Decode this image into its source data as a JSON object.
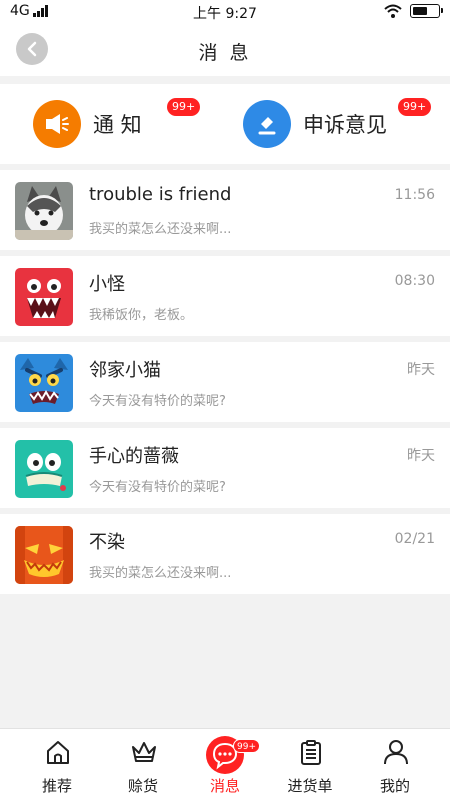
{
  "status_bar": {
    "carrier": "4G",
    "time": "上午 9:27",
    "battery_level": 0.6
  },
  "header": {
    "title": "消 息"
  },
  "categories": [
    {
      "label": "通 知",
      "badge": "99+",
      "icon": "megaphone-icon",
      "color": "#f57c00"
    },
    {
      "label": "申诉意见",
      "badge": "99+",
      "icon": "gavel-icon",
      "color": "#2e8ae6"
    }
  ],
  "messages": [
    {
      "name": "trouble is friend",
      "time": "11:56",
      "preview": "我买的菜怎么还没来啊...",
      "avatar": "husky-dog-avatar"
    },
    {
      "name": "小怪",
      "time": "08:30",
      "preview": "我稀饭你，老板。",
      "avatar": "red-monster-avatar"
    },
    {
      "name": "邻家小猫",
      "time": "昨天",
      "preview": "今天有没有特价的菜呢?",
      "avatar": "blue-monster-avatar"
    },
    {
      "name": "手心的蔷薇",
      "time": "昨天",
      "preview": "今天有没有特价的菜呢?",
      "avatar": "green-monster-avatar"
    },
    {
      "name": "不染",
      "time": "02/21",
      "preview": "我买的菜怎么还没来啊...",
      "avatar": "pumpkin-avatar"
    }
  ],
  "tabs": [
    {
      "label": "推荐",
      "icon": "home-icon"
    },
    {
      "label": "赊货",
      "icon": "crown-icon"
    },
    {
      "label": "消息",
      "icon": "chat-icon",
      "badge": "99+",
      "active": true
    },
    {
      "label": "进货单",
      "icon": "clipboard-icon"
    },
    {
      "label": "我的",
      "icon": "user-icon"
    }
  ],
  "colors": {
    "accent": "#ff2222",
    "notice": "#f57c00",
    "appeal": "#2e8ae6"
  }
}
